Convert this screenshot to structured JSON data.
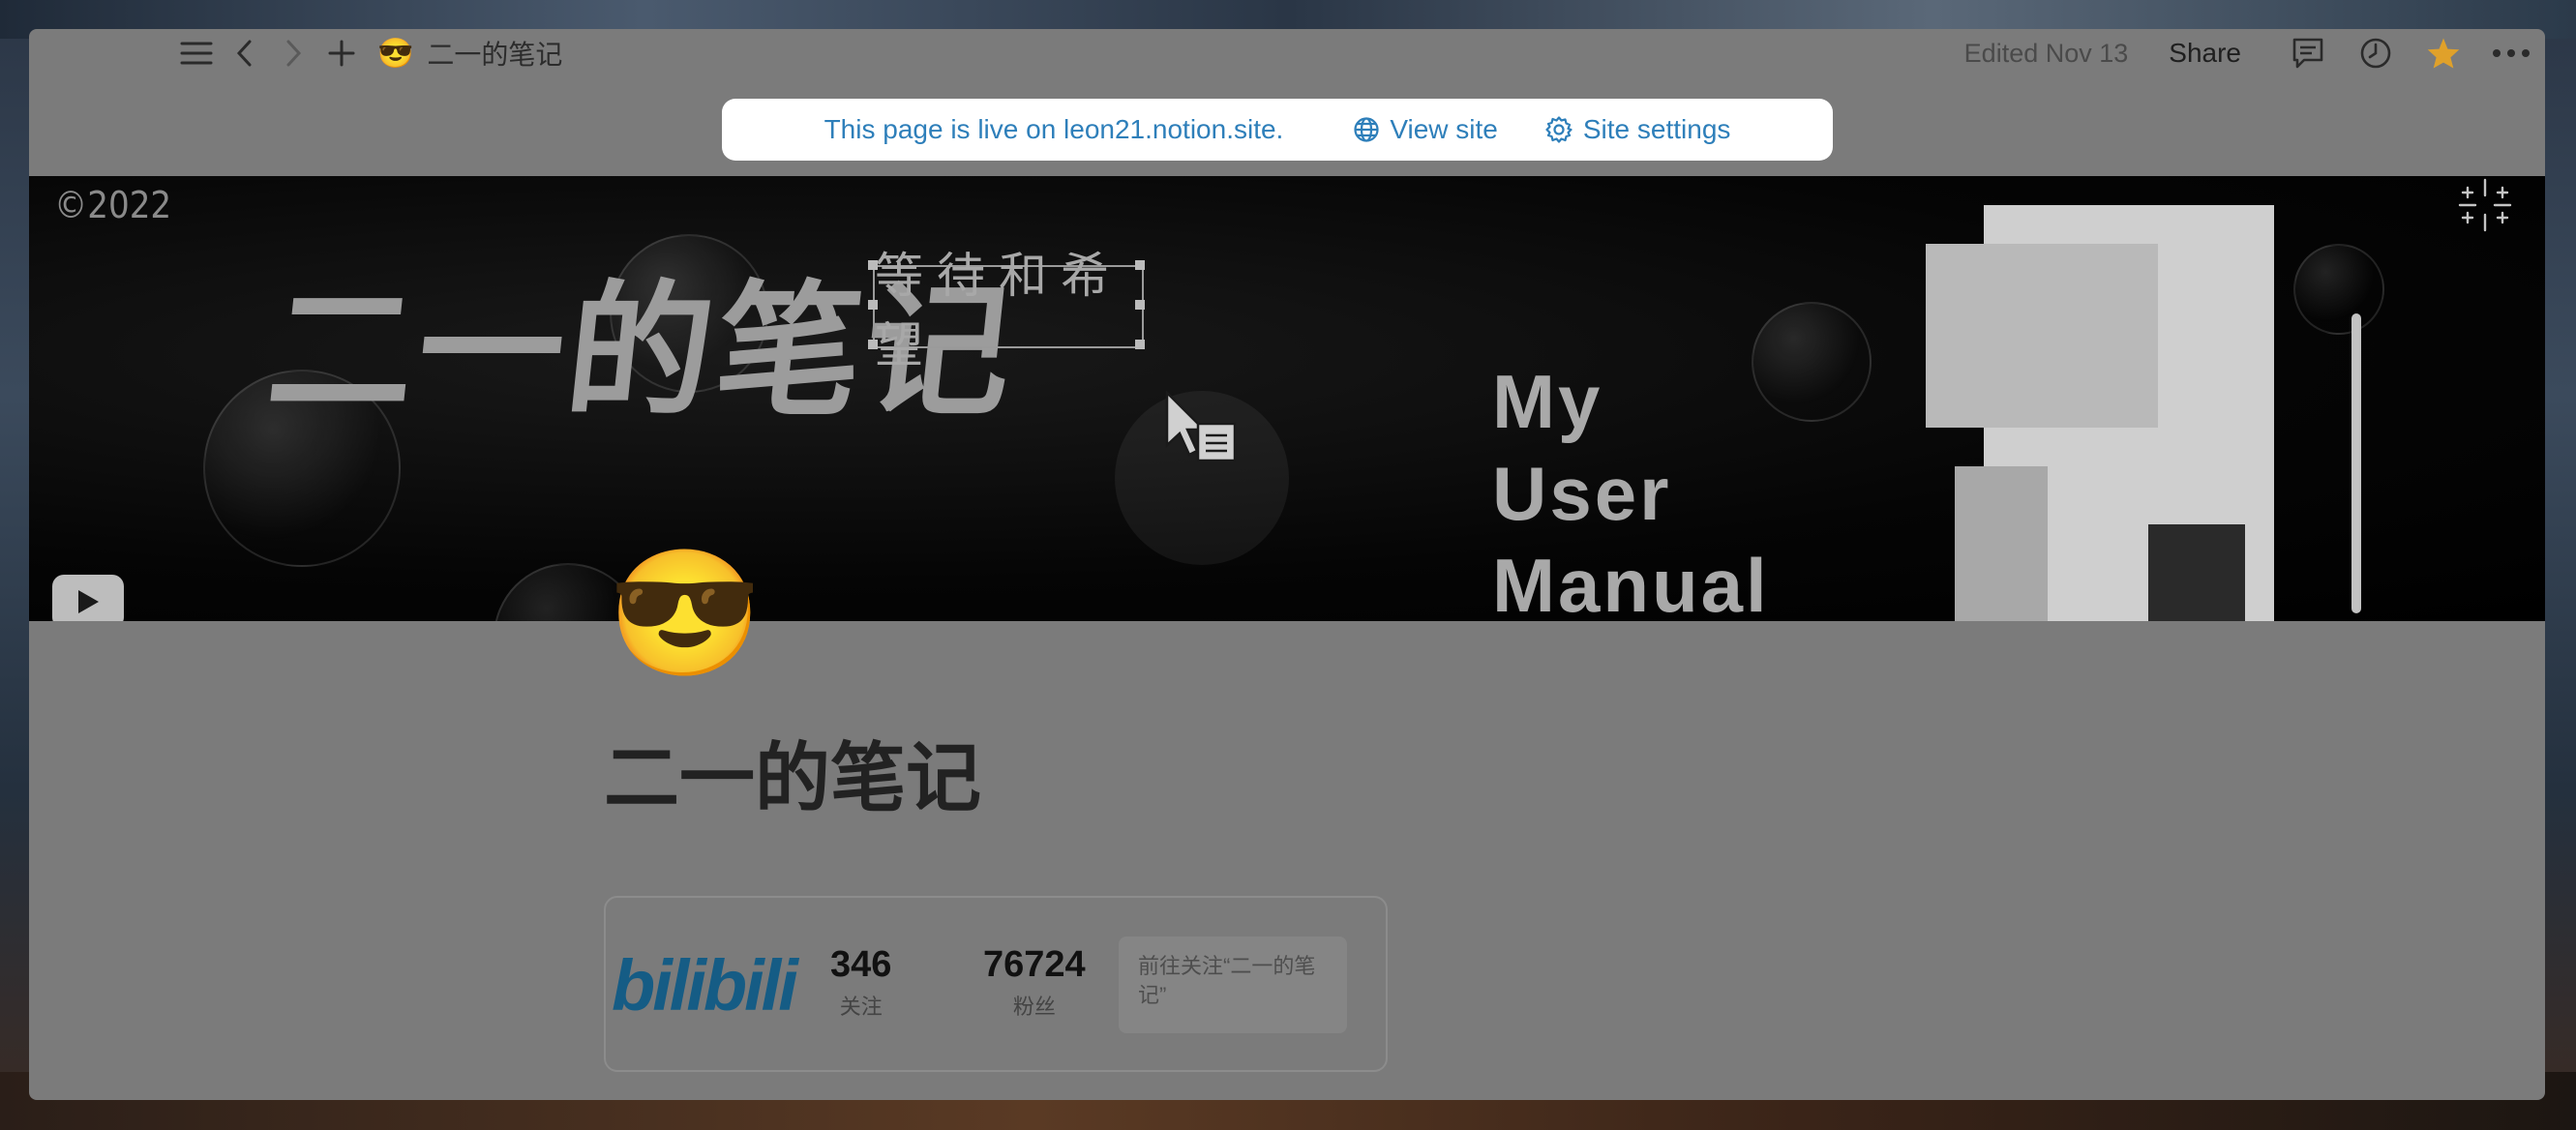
{
  "topbar": {
    "page_emoji": "😎",
    "page_title": "二一的笔记",
    "edited": "Edited Nov 13",
    "share": "Share",
    "icons": [
      "menu-icon",
      "back-icon",
      "forward-icon",
      "add-icon",
      "comments-icon",
      "history-icon",
      "favorite-star-icon",
      "more-icon"
    ],
    "star_color": "#e0a12a"
  },
  "live_banner": {
    "message": "This page is live on leon21.notion.site.",
    "view_site": "View site",
    "site_settings": "Site settings",
    "link_color": "#2e7fba"
  },
  "cover": {
    "copyright": "©2022",
    "title": "二一的笔记",
    "tag": "等待和希望",
    "manual_lines": [
      "My",
      "User",
      "Manual"
    ]
  },
  "page": {
    "emoji": "😎",
    "title": "二一的笔记"
  },
  "bilibili_card": {
    "logo": "bilibili",
    "following_count": "346",
    "following_label": "关注",
    "followers_count": "76724",
    "followers_label": "粉丝",
    "follow_button": "前往关注“二一的笔记”",
    "brand_color": "#155c85"
  }
}
